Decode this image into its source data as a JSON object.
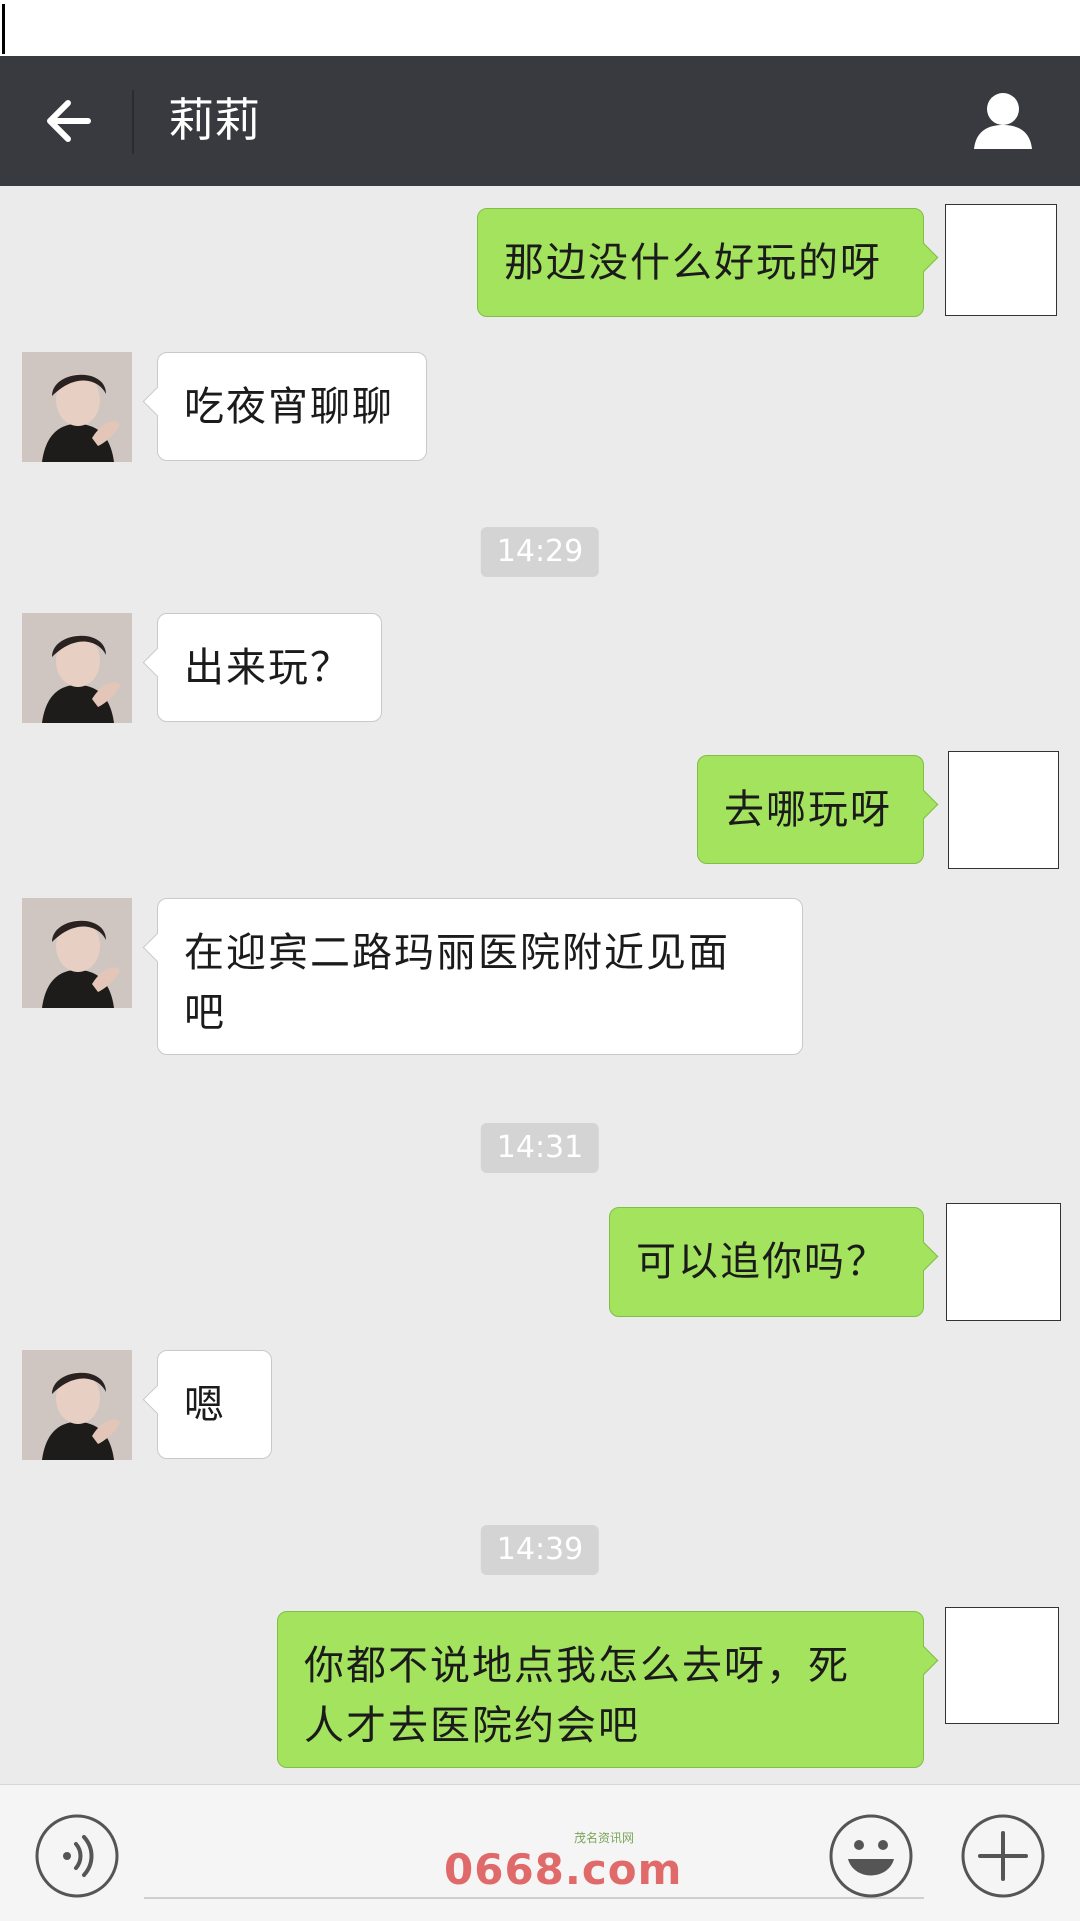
{
  "header": {
    "title": "莉莉"
  },
  "messages": [
    {
      "side": "out",
      "text": "那边没什么好玩的呀"
    },
    {
      "side": "in",
      "text": "吃夜宵聊聊"
    },
    {
      "timestamp": "14:29"
    },
    {
      "side": "in",
      "text": "出来玩？"
    },
    {
      "side": "out",
      "text": "去哪玩呀"
    },
    {
      "side": "in",
      "text": "在迎宾二路玛丽医院附近见面吧"
    },
    {
      "timestamp": "14:31"
    },
    {
      "side": "out",
      "text": "可以追你吗？"
    },
    {
      "side": "in",
      "text": "嗯"
    },
    {
      "timestamp": "14:39"
    },
    {
      "side": "out",
      "text": "你都不说地点我怎么去呀，死人才去医院约会吧"
    }
  ],
  "watermark": {
    "main": "0668.com",
    "small": "茂名资讯网"
  },
  "colors": {
    "header_bg": "#393a3f",
    "chat_bg": "#ebebeb",
    "outgoing_bubble": "#a3e35d",
    "incoming_bubble": "#ffffff",
    "timestamp_bg": "#d4d4d4"
  },
  "icons": {
    "back": "arrow-left-icon",
    "profile": "person-icon",
    "voice": "voice-icon",
    "emoji": "smiley-icon",
    "more": "plus-icon"
  }
}
